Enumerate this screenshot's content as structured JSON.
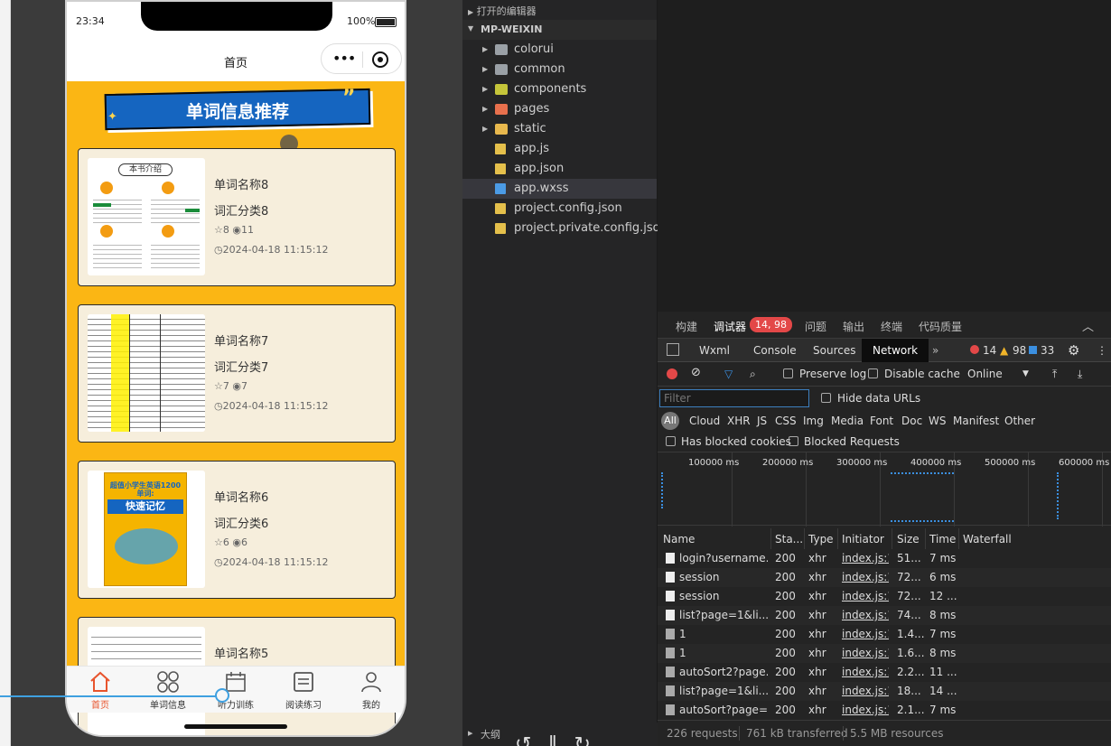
{
  "phone": {
    "time": "23:34",
    "battery": "100%",
    "title": "首页",
    "banner": "单词信息推荐",
    "cards": [
      {
        "title": "单词名称8",
        "category": "词汇分类8",
        "stars": "8",
        "views": "11",
        "time": "2024-04-18 11:15:12",
        "thumb": "intro"
      },
      {
        "title": "单词名称7",
        "category": "词汇分类7",
        "stars": "7",
        "views": "7",
        "time": "2024-04-18 11:15:12",
        "thumb": "table"
      },
      {
        "title": "单词名称6",
        "category": "词汇分类6",
        "stars": "6",
        "views": "6",
        "time": "2024-04-18 11:15:12",
        "thumb": "book"
      },
      {
        "title": "单词名称5",
        "category": "",
        "stars": "",
        "views": "",
        "time": "",
        "thumb": "list"
      }
    ],
    "thumb_text": {
      "intro": "本书介绍",
      "book": "超值小学生英语1200单词:",
      "book2": "快速记忆"
    },
    "tabs": [
      {
        "label": "首页",
        "icon": "home-icon",
        "active": true
      },
      {
        "label": "单词信息",
        "icon": "grid-icon"
      },
      {
        "label": "听力训练",
        "icon": "calendar-icon"
      },
      {
        "label": "阅读练习",
        "icon": "notebook-icon"
      },
      {
        "label": "我的",
        "icon": "user-icon"
      }
    ],
    "brand_color": "#fbb614",
    "banner_color": "#1565c0"
  },
  "explorer": {
    "section_open": "打开的编辑器",
    "project": "MP-WEIXIN",
    "items": [
      {
        "label": "colorui",
        "type": "folder",
        "color": "#9aa0a6",
        "arrow": true
      },
      {
        "label": "common",
        "type": "folder",
        "color": "#9aa0a6",
        "arrow": true
      },
      {
        "label": "components",
        "type": "folder",
        "color": "#c5c53a",
        "arrow": true
      },
      {
        "label": "pages",
        "type": "folder",
        "color": "#e8704d",
        "arrow": true
      },
      {
        "label": "static",
        "type": "folder",
        "color": "#e8b84d",
        "arrow": true
      },
      {
        "label": "app.js",
        "type": "js",
        "color": "#e5c04b"
      },
      {
        "label": "app.json",
        "type": "json",
        "color": "#e5c04b"
      },
      {
        "label": "app.wxss",
        "type": "css",
        "color": "#4b9be5",
        "selected": true
      },
      {
        "label": "project.config.json",
        "type": "json",
        "color": "#e5c04b"
      },
      {
        "label": "project.private.config.json",
        "type": "json",
        "color": "#e5c04b"
      }
    ],
    "outline": "大纲"
  },
  "devtools": {
    "top_tabs": [
      "构建",
      "调试器",
      "问题",
      "输出",
      "终端",
      "代码质量"
    ],
    "badge": "14, 98",
    "panel_tabs": [
      "Wxml",
      "Console",
      "Sources",
      "Network"
    ],
    "more": "»",
    "counts": {
      "errors": "14",
      "warnings": "98",
      "info": "33"
    },
    "toolbar": {
      "preserve_log": "Preserve log",
      "disable_cache": "Disable cache",
      "throttle": "Online"
    },
    "filter_placeholder": "Filter",
    "hide_data_urls": "Hide data URLs",
    "types": [
      "All",
      "Cloud",
      "XHR",
      "JS",
      "CSS",
      "Img",
      "Media",
      "Font",
      "Doc",
      "WS",
      "Manifest",
      "Other"
    ],
    "blocked_cookies": "Has blocked cookies",
    "blocked_requests": "Blocked Requests",
    "timeline": [
      "100000 ms",
      "200000 ms",
      "300000 ms",
      "400000 ms",
      "500000 ms",
      "600000 ms"
    ],
    "columns": [
      "Name",
      "Sta...",
      "Type",
      "Initiator",
      "Size",
      "Time",
      "Waterfall"
    ],
    "rows": [
      {
        "name": "login?username...",
        "status": "200",
        "type": "xhr",
        "initiator": "index.js:1",
        "size": "51...",
        "time": "7 ms",
        "icon": "doc"
      },
      {
        "name": "session",
        "status": "200",
        "type": "xhr",
        "initiator": "index.js:1",
        "size": "72...",
        "time": "6 ms",
        "icon": "doc"
      },
      {
        "name": "session",
        "status": "200",
        "type": "xhr",
        "initiator": "index.js:1",
        "size": "72...",
        "time": "12 ...",
        "icon": "doc"
      },
      {
        "name": "list?page=1&li...",
        "status": "200",
        "type": "xhr",
        "initiator": "index.js:1",
        "size": "74...",
        "time": "8 ms",
        "icon": "doc"
      },
      {
        "name": "1",
        "status": "200",
        "type": "xhr",
        "initiator": "index.js:1",
        "size": "1.4...",
        "time": "7 ms",
        "icon": "gray"
      },
      {
        "name": "1",
        "status": "200",
        "type": "xhr",
        "initiator": "index.js:1",
        "size": "1.6...",
        "time": "8 ms",
        "icon": "gray"
      },
      {
        "name": "autoSort2?page...",
        "status": "200",
        "type": "xhr",
        "initiator": "index.js:1",
        "size": "2.2...",
        "time": "11 ...",
        "icon": "gray"
      },
      {
        "name": "list?page=1&li...",
        "status": "200",
        "type": "xhr",
        "initiator": "index.js:1",
        "size": "18...",
        "time": "14 ...",
        "icon": "gray"
      },
      {
        "name": "autoSort?page=...",
        "status": "200",
        "type": "xhr",
        "initiator": "index.js:1",
        "size": "2.1...",
        "time": "7 ms",
        "icon": "gray"
      }
    ],
    "footer": [
      "226 requests",
      "761 kB transferred",
      "5.5 MB resources"
    ]
  }
}
